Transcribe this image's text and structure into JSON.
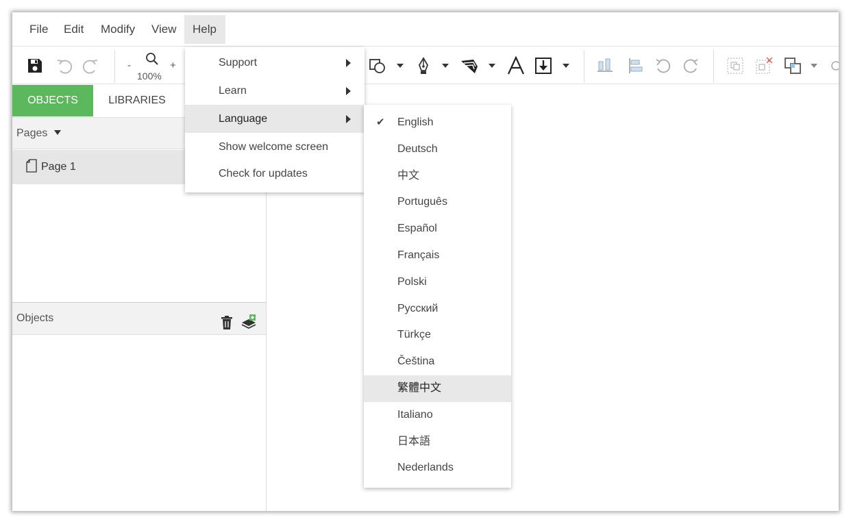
{
  "menubar": {
    "items": [
      {
        "label": "File"
      },
      {
        "label": "Edit"
      },
      {
        "label": "Modify"
      },
      {
        "label": "View"
      },
      {
        "label": "Help"
      }
    ]
  },
  "toolbar": {
    "zoom_minus": "-",
    "zoom_plus": "+",
    "zoom_level": "100%"
  },
  "left_panel": {
    "tabs": [
      {
        "label": "OBJECTS",
        "active": true
      },
      {
        "label": "LIBRARIES",
        "active": false
      }
    ],
    "pages_label": "Pages",
    "pages": [
      {
        "label": "Page 1"
      }
    ],
    "objects_label": "Objects"
  },
  "help_menu": {
    "items": [
      {
        "label": "Support"
      },
      {
        "label": "Learn"
      },
      {
        "label": "Language"
      },
      {
        "label": "Show welcome screen"
      },
      {
        "label": "Check for updates"
      }
    ]
  },
  "language_menu": {
    "selected": "English",
    "hovered": "繁體中文",
    "items": [
      {
        "label": "English"
      },
      {
        "label": "Deutsch"
      },
      {
        "label": "中文"
      },
      {
        "label": "Português"
      },
      {
        "label": "Español"
      },
      {
        "label": "Français"
      },
      {
        "label": "Polski"
      },
      {
        "label": "Русский"
      },
      {
        "label": "Türkçe"
      },
      {
        "label": "Čeština"
      },
      {
        "label": "繁體中文"
      },
      {
        "label": "Italiano"
      },
      {
        "label": "日本語"
      },
      {
        "label": "Nederlands"
      }
    ]
  },
  "colors": {
    "accent": "#5cb85c",
    "menu_highlight": "#e8e8e8"
  }
}
